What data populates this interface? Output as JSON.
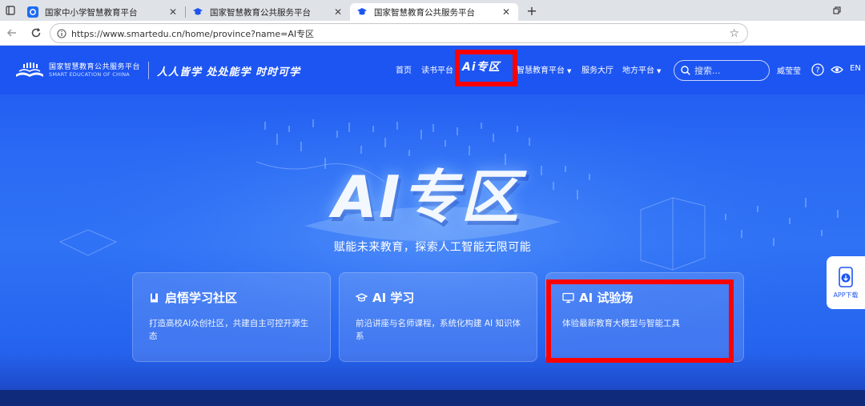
{
  "browser": {
    "tabs": [
      {
        "title": "国家中小学智慧教育平台",
        "active": false
      },
      {
        "title": "国家智慧教育公共服务平台",
        "active": false
      },
      {
        "title": "国家智慧教育公共服务平台",
        "active": true
      }
    ],
    "url": "https://www.smartedu.cn/home/province?name=AI专区",
    "new_tab_symbol": "+",
    "close_symbol": "✕"
  },
  "site": {
    "logo_cn": "国家智慧教育公共服务平台",
    "logo_en": "SMART EDUCATION OF CHINA",
    "slogan": "人人皆学 处处能学 时时可学",
    "nav": {
      "home": "首页",
      "reading": "读书平台",
      "ai_zone": "Ai专区",
      "smart_platform": "智慧教育平台",
      "service_hall": "服务大厅",
      "local_platform": "地方平台"
    },
    "search_placeholder": "搜索...",
    "user_name": "威莹莹",
    "lang": "EN"
  },
  "hero": {
    "title": "AI专区",
    "subtitle": "赋能未来教育，探索人工智能无限可能"
  },
  "cards": [
    {
      "title": "启悟学习社区",
      "desc": "打造高校AI众创社区，共建自主可控开源生态"
    },
    {
      "title": "AI 学习",
      "desc": "前沿讲座与名师课程，系统化构建 AI 知识体系"
    },
    {
      "title": "AI 试验场",
      "desc": "体验最新教育大模型与智能工具"
    }
  ],
  "app_download": "APP下载",
  "colors": {
    "brand_blue": "#1d55f2",
    "highlight_red": "#ff0000",
    "tab_strip": "#dfe3e8"
  }
}
